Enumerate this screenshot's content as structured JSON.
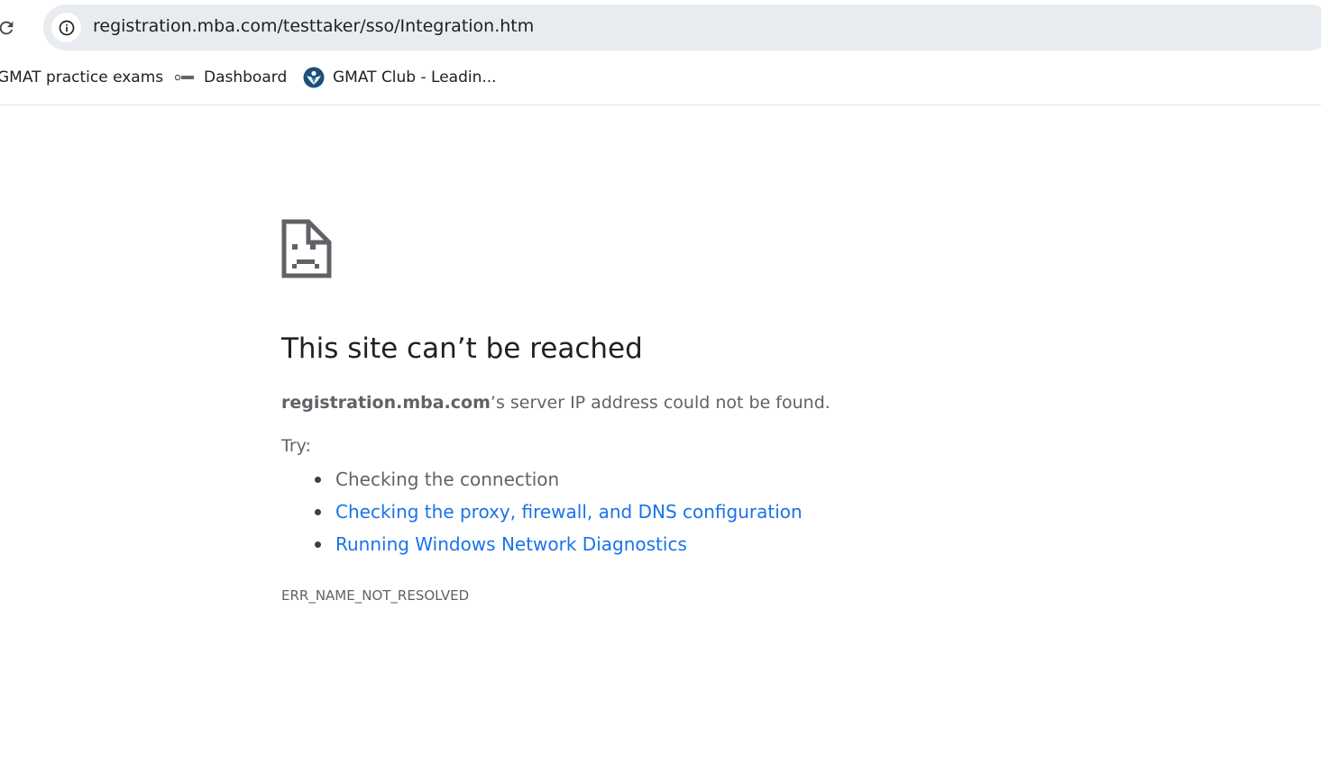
{
  "browser": {
    "url": "registration.mba.com/testtaker/sso/Integration.htm",
    "bookmarks": [
      {
        "label": "GMAT practice exams",
        "icon": "none"
      },
      {
        "label": "Dashboard",
        "icon": "gmat-logo-icon"
      },
      {
        "label": "GMAT Club - Leadin...",
        "icon": "gmat-club-icon"
      }
    ]
  },
  "error_page": {
    "title": "This site can’t be reached",
    "host": "registration.mba.com",
    "message": "’s server IP address could not be found.",
    "try_label": "Try:",
    "suggestions": [
      {
        "label": "Checking the connection",
        "link": false
      },
      {
        "label": "Checking the proxy, firewall, and DNS configuration",
        "link": true
      },
      {
        "label": "Running Windows Network Diagnostics",
        "link": true
      }
    ],
    "error_code": "ERR_NAME_NOT_RESOLVED"
  },
  "colors": {
    "link": "#1a73e8",
    "text_secondary": "#5f6368",
    "omnibox_bg": "#e8ebf0"
  }
}
